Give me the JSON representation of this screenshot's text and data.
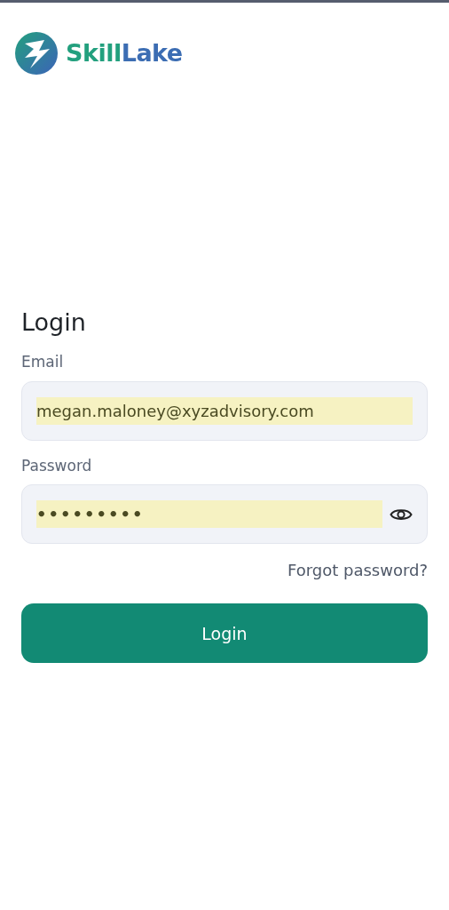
{
  "logo": {
    "first": "Skill",
    "second": "Lake"
  },
  "title": "Login",
  "fields": [
    {
      "label": "Email",
      "value": "megan.maloney@xyzadvisory.com",
      "autofilled": true,
      "kind": "text"
    },
    {
      "label": "Password",
      "value": "•••••••••",
      "autofilled": true,
      "kind": "password"
    }
  ],
  "forgot_link": "Forgot password?",
  "submit": "Login"
}
